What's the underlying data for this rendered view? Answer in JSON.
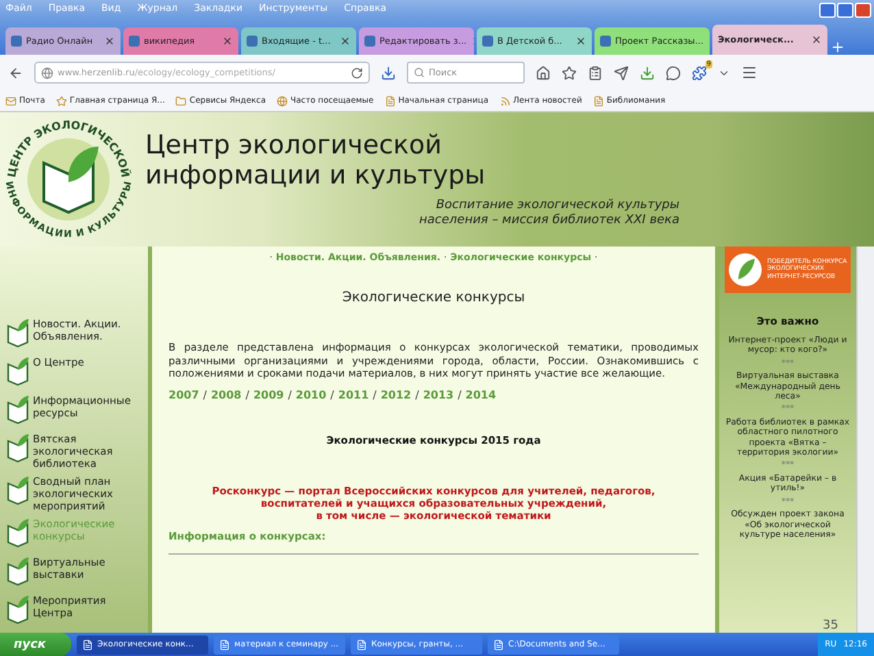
{
  "menu": [
    "Файл",
    "Правка",
    "Вид",
    "Журнал",
    "Закладки",
    "Инструменты",
    "Справка"
  ],
  "tabs": [
    {
      "label": "Радио Онлайн",
      "selected": false,
      "color": "#b9a9d6"
    },
    {
      "label": "википедия",
      "selected": false,
      "color": "#e07aa8"
    },
    {
      "label": "Входящие - t...",
      "selected": false,
      "color": "#7fc6c6"
    },
    {
      "label": "Редактировать з...",
      "selected": false,
      "color": "#c79be0"
    },
    {
      "label": "В Детской б...",
      "selected": false,
      "color": "#8fd6c8"
    },
    {
      "label": "Проект Рассказы...",
      "selected": false,
      "color": "#8fe07a"
    },
    {
      "label": "Экологическ...",
      "selected": true,
      "color": "#e7c3d6"
    }
  ],
  "address": {
    "host": "www.herzenlib.ru",
    "path": "/ecology/ecology_competitions/"
  },
  "search": {
    "placeholder": "Поиск"
  },
  "toolbar_badge": "9",
  "bookmarks": [
    "Почта",
    "Главная страница Я...",
    "Сервисы Яндекса",
    "Часто посещаемые",
    "Начальная страница",
    "Лента новостей",
    "Библиомания"
  ],
  "site": {
    "logo_top": "ЦЕНТР ЭКОЛОГИЧЕСКОЙ",
    "logo_bottom": "ИНФОРМАЦИИ И КУЛЬТУРЫ",
    "title": [
      "Центр экологической",
      "информации и культуры"
    ],
    "motto": [
      "Воспитание экологической культуры",
      "населения – миссия библиотек XXI века"
    ],
    "sidebar": [
      {
        "label": "Новости. Акции. Объявления.",
        "selected": false
      },
      {
        "label": "О Центре",
        "selected": false
      },
      {
        "label": "Информационные ресурсы",
        "selected": false
      },
      {
        "label": "Вятская экологическая библиотека",
        "selected": false
      },
      {
        "label": "Сводный план экологических мероприятий",
        "selected": false
      },
      {
        "label": "Экологические конкурсы",
        "selected": true
      },
      {
        "label": "Виртуальные выставки",
        "selected": false
      },
      {
        "label": "Мероприятия Центра",
        "selected": false
      }
    ],
    "breadcrumb": [
      "Новости. Акции. Объявления.",
      "Экологические конкурсы"
    ],
    "breadcrumb_separator": "·",
    "year_separator": "/",
    "heading": "Экологические конкурсы",
    "intro": "В разделе представлена информация о конкурсах экологической тематики, проводимых различными организациями и учреждениями города, области, России. Ознакомившись с положениями и сроками подачи материалов, в них могут принять участие все желающие.",
    "years": [
      "2007",
      "2008",
      "2009",
      "2010",
      "2011",
      "2012",
      "2013",
      "2014"
    ],
    "subheading": "Экологические конкурсы 2015 года",
    "promo": [
      "Росконкурс — портал Всероссийских конкурсов для учителей, педагогов,",
      "воспитателей и учащихся образовательных учреждений,",
      "в том числе — экологической тематики"
    ],
    "info_heading": "Информация о конкурсах:",
    "award": "ПОБЕДИТЕЛЬ КОНКУРСА ЭКОЛОГИЧЕСКИХ ИНТЕРНЕТ-РЕСУРСОВ",
    "important_title": "Это важно",
    "important": [
      {
        "kind": "link",
        "text": "Интернет-проект «Люди и мусор: кто кого?»"
      },
      {
        "kind": "separator",
        "text": "***"
      },
      {
        "kind": "link",
        "text": "Виртуальная выставка «Международный день леса»"
      },
      {
        "kind": "separator",
        "text": "***"
      },
      {
        "kind": "link",
        "text": "Работа библиотек в рамках областного пилотного проекта «Вятка – территория экологии»"
      },
      {
        "kind": "separator",
        "text": "***"
      },
      {
        "kind": "link",
        "text": "Акция «Батарейки – в утиль!»"
      },
      {
        "kind": "separator",
        "text": "***"
      },
      {
        "kind": "link",
        "text": "Обсужден проект закона «Об экологической культуре населения»"
      }
    ],
    "slide_number": "35"
  },
  "taskbar": {
    "start": "пуск",
    "tasks": [
      {
        "label": "Экологические конк...",
        "selected": true
      },
      {
        "label": "материал к семинару ...",
        "selected": false
      },
      {
        "label": "Конкурсы, гранты, ...",
        "selected": false
      },
      {
        "label": "C:\\Documents and Se...",
        "selected": false
      }
    ],
    "lang": "RU",
    "clock": "12:16"
  }
}
